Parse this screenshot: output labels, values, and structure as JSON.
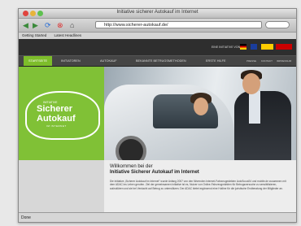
{
  "window": {
    "title": "Initiative sicherer Autokauf im Internet"
  },
  "toolbar": {
    "url": "http://www.sicherer-autokauf.de/"
  },
  "bookmarks": [
    "Getting Started",
    "Latest Headlines"
  ],
  "topbar": {
    "text": "EINE INITIATIVE VON"
  },
  "nav": {
    "items": [
      "STARTSEITE",
      "INITIATOREN",
      "AUTOKAUF",
      "BEKANNTE BETRUGSMETHODEN",
      "ERSTE HILFE"
    ],
    "right_links": [
      "PRESSE",
      "KONTAKT",
      "IMPRESSUM"
    ]
  },
  "logo": {
    "top": "INITIATIVE",
    "line1": "Sicherer",
    "line2": "Autokauf",
    "sub": "IM INTERNET"
  },
  "content": {
    "welcome1": "Willkommen bei der",
    "welcome2": "Initiative Sicherer Autokauf im Internet",
    "paragraph": "Die Initiative „Sicherer Autokauf im Internet\" wurde Anfang 2007 von den führenden Internet-Fahrzeugmärkten AutoScout24 und mobile.de zusammen mit dem ADAC ins Leben gerufen. Ziel der gemeinsamen Initiative ist es, Nutzer von Online-Fahrzeugmärkten für Betrugsversuche zu sensibilisieren, aufzuklären und sie bei Verdacht auf Betrug zu unterstützen. Der ADAC bietet ergänzend eine Hotline für die juristische Erstberatung der Mitglieder an."
  },
  "status": {
    "text": "Done"
  }
}
